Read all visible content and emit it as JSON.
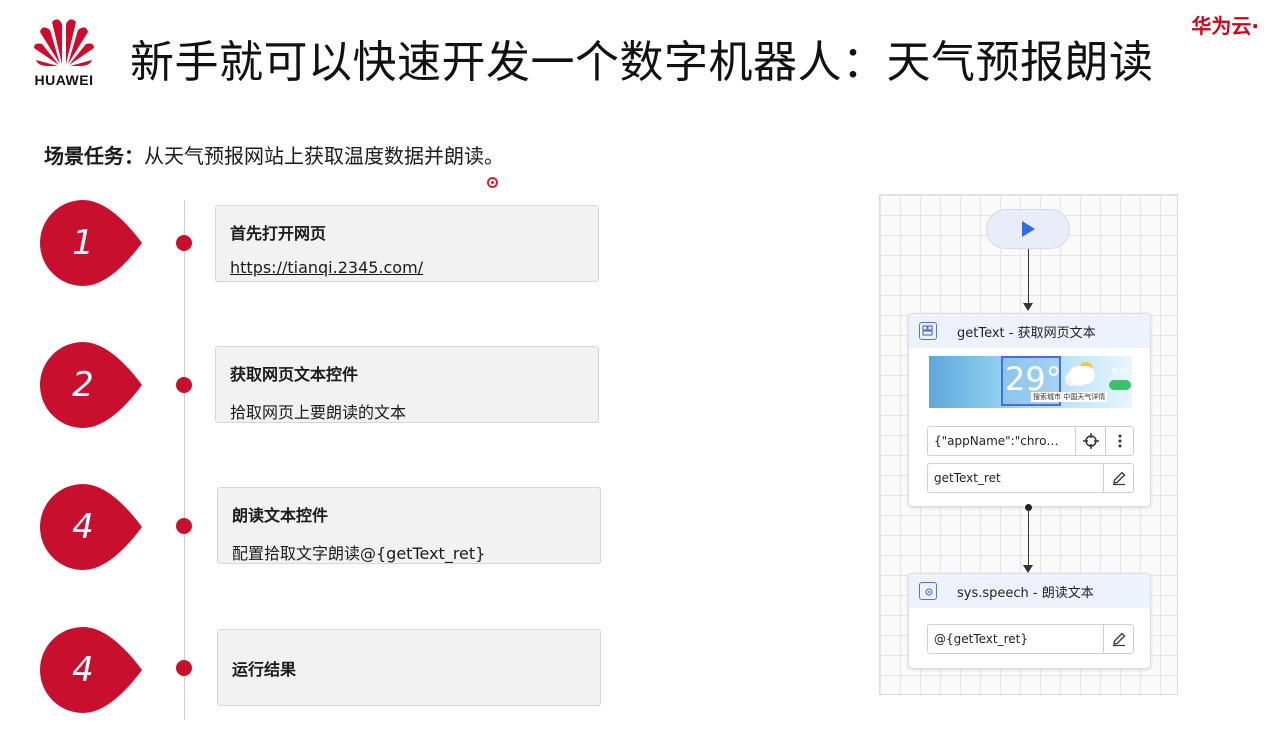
{
  "header": {
    "logo_text": "HUAWEI",
    "title": "新手就可以快速开发一个数字机器人：天气预报朗读",
    "brand": "华为云·"
  },
  "task": {
    "label": "场景任务：",
    "text": "从天气预报网站上获取温度数据并朗读。"
  },
  "colors": {
    "accent_red": "#c8102e",
    "node_blue": "#4b78d9"
  },
  "steps": [
    {
      "number": "1",
      "heading": "首先打开网页",
      "detail": "https://tianqi.2345.com/"
    },
    {
      "number": "2",
      "heading": "获取网页文本控件",
      "detail": "拾取网页上要朗读的文本"
    },
    {
      "number": "4",
      "heading": "朗读文本控件",
      "detail": "配置拾取文字朗读@{getText_ret}"
    },
    {
      "number": "4",
      "heading": "运行结果",
      "detail": ""
    }
  ],
  "flow": {
    "start_icon": "play-icon",
    "node1": {
      "title": "getText - 获取网页文本",
      "icon": "web-element-icon",
      "thumbnail": {
        "temperature": "29°",
        "caption": "搜索城市 中国天气详情",
        "weather": "多云"
      },
      "target_value": "{\"appName\":\"chro…",
      "output_value": "getText_ret"
    },
    "node2": {
      "title": "sys.speech - 朗读文本",
      "icon": "speech-gear-icon",
      "input_value": "@{getText_ret}"
    }
  }
}
